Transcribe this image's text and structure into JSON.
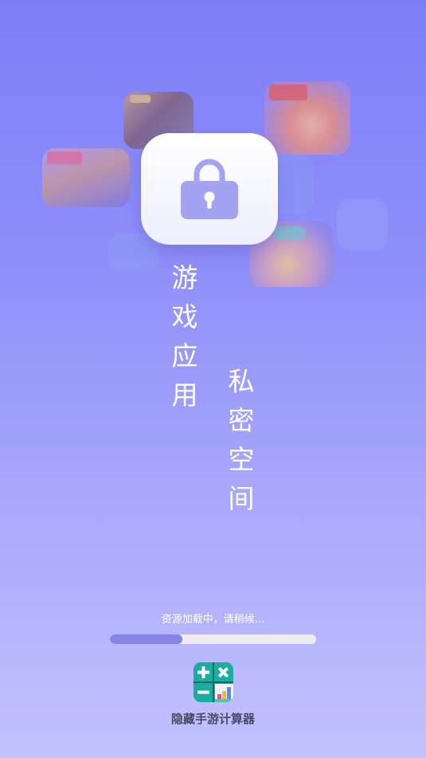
{
  "splash": {
    "title_column_1": [
      "游",
      "戏",
      "应",
      "用"
    ],
    "title_column_2": [
      "私",
      "密",
      "空",
      "间"
    ]
  },
  "loading": {
    "text": "资源加载中，请稍候...",
    "progress": 0.35
  },
  "app": {
    "name": "隐藏手游计算器",
    "logo_icon": "calculator-icon"
  },
  "background_icons": [
    "game-icon-1",
    "game-icon-2",
    "game-icon-3",
    "game-icon-4"
  ],
  "center_icon": "lock-icon",
  "colors": {
    "background_top": "#7f7ef8",
    "background_bottom": "#c3c2fe",
    "accent": "#8584e8",
    "lock": "#a4a3f1",
    "logo_teal": "#1aa59a"
  }
}
